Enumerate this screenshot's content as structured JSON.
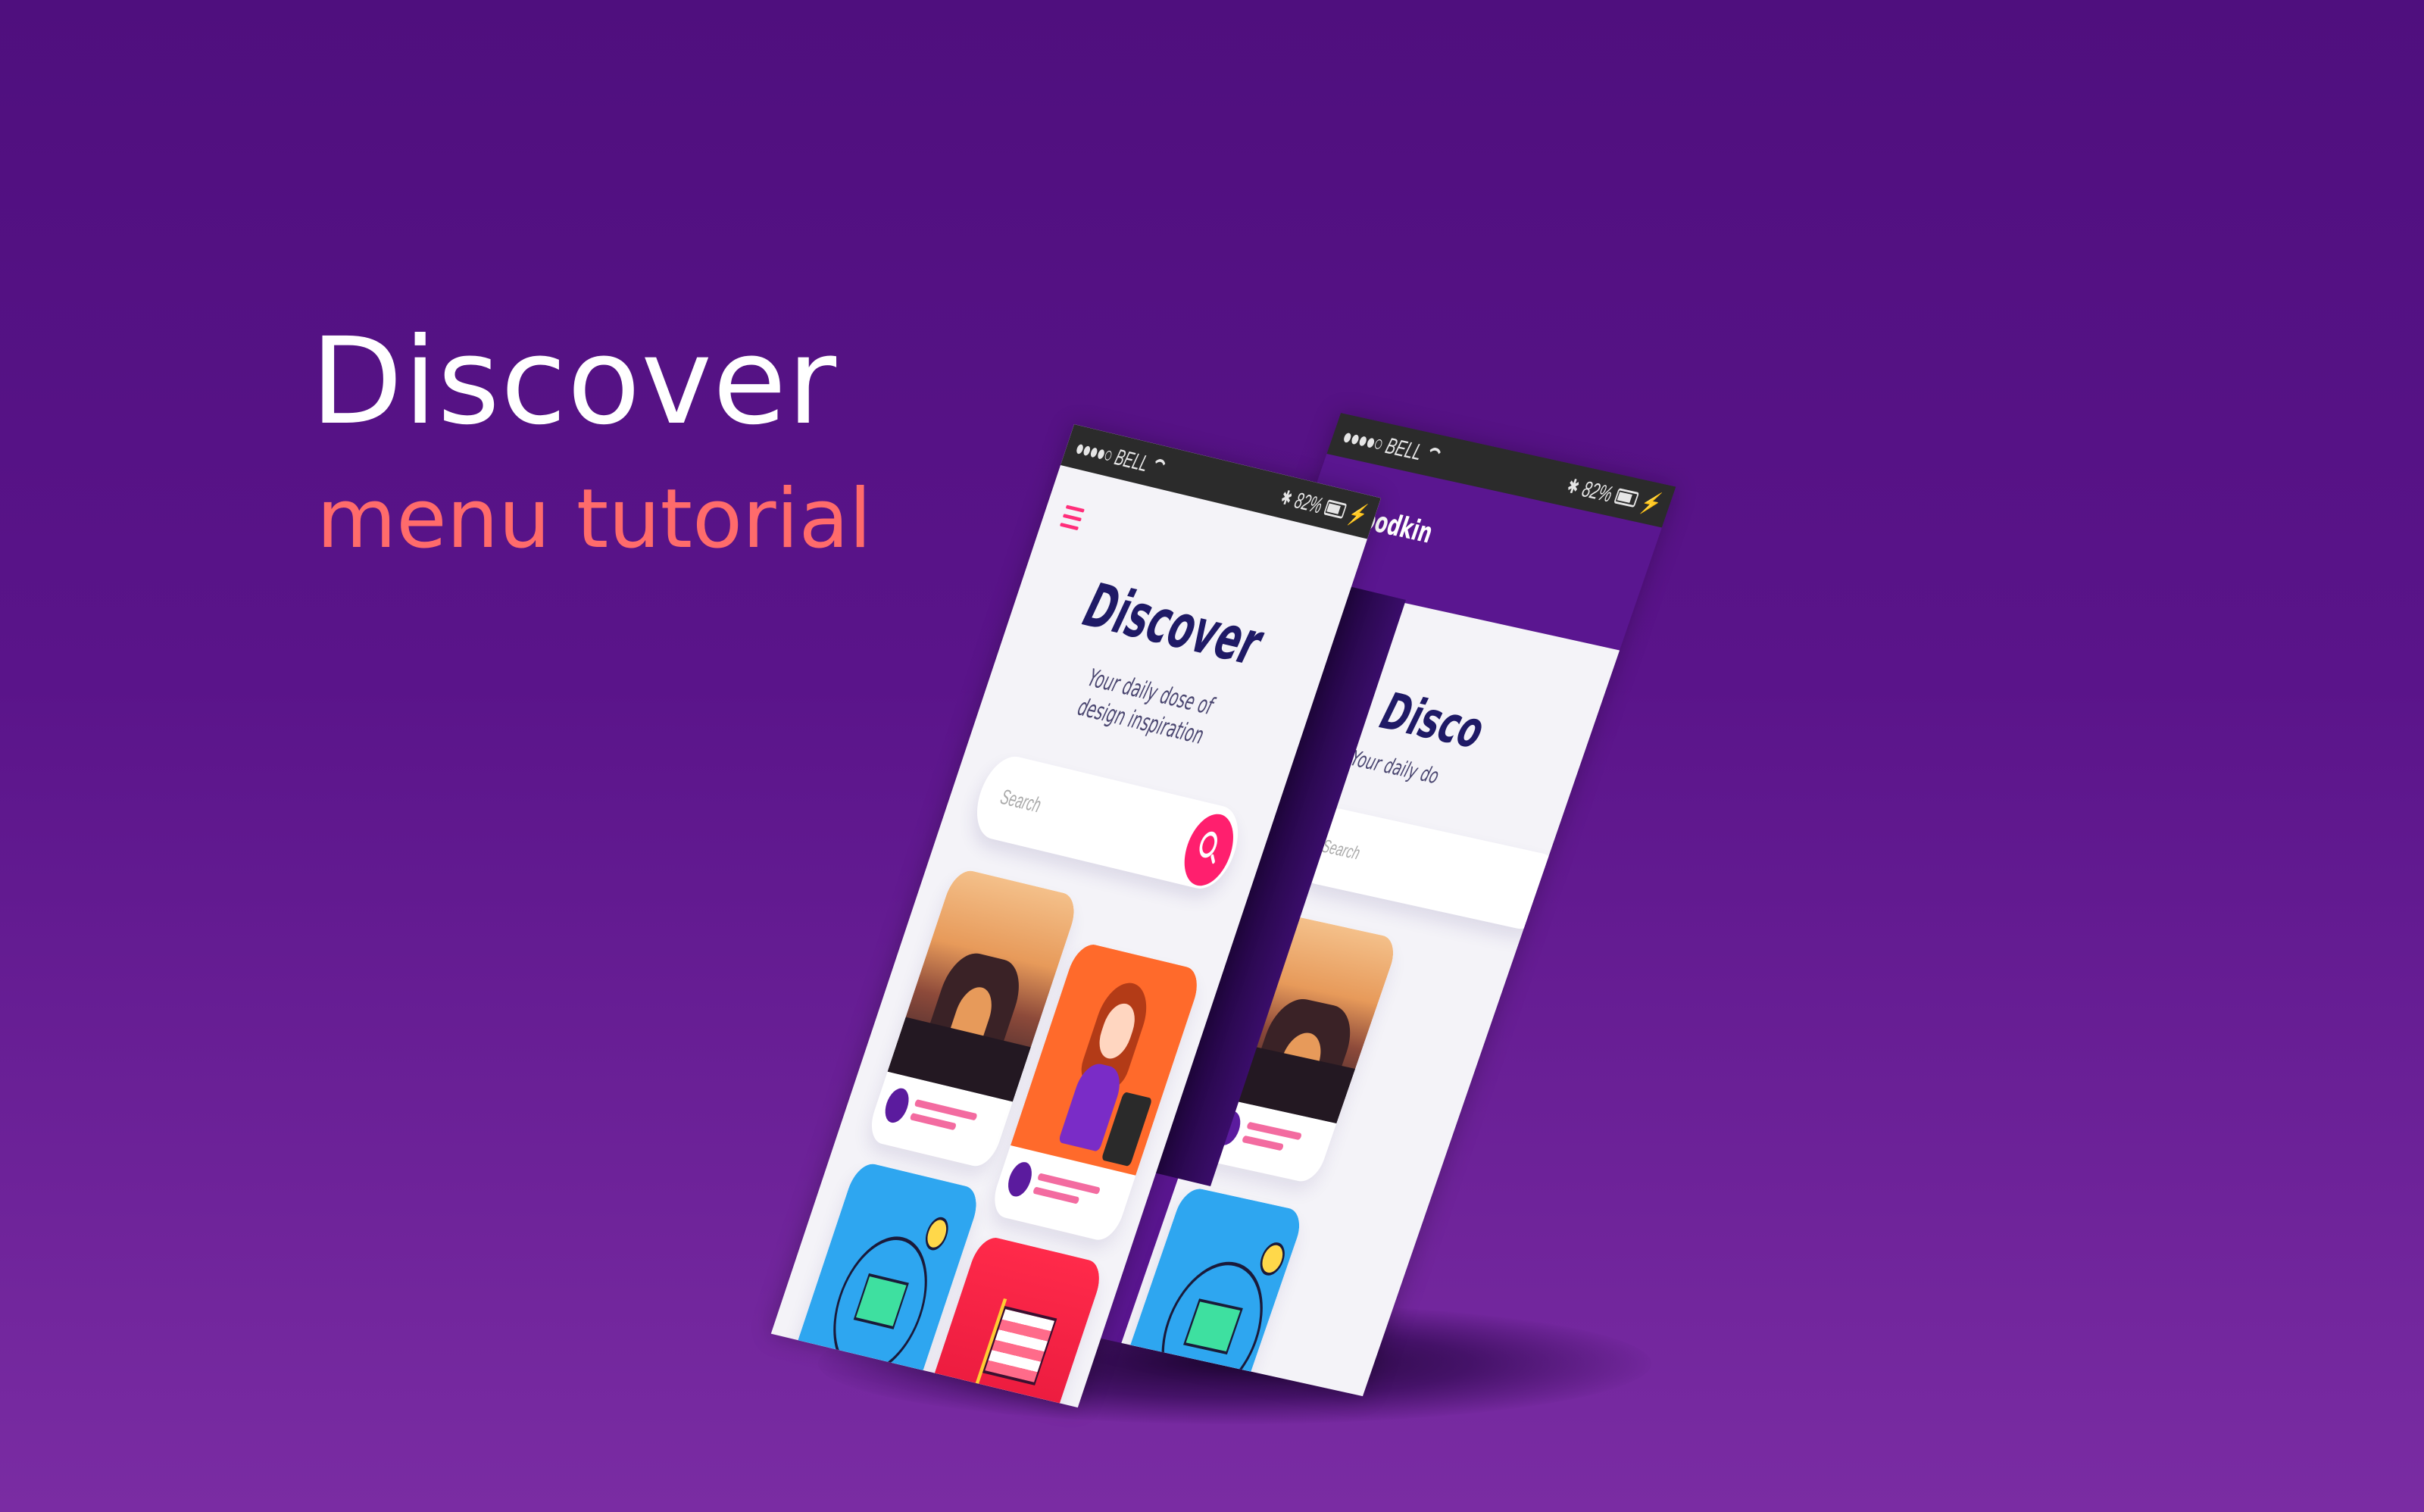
{
  "hero": {
    "title": "Discover",
    "subtitle": "menu tutorial"
  },
  "status_bar": {
    "carrier_signal": "●●●●○",
    "carrier": "BELL",
    "bluetooth": "✱",
    "battery_percent": "82%",
    "charging": "⚡"
  },
  "front_screen": {
    "title": "Discover",
    "tagline": "Your daily dose of design inspiration",
    "search_placeholder": "Search",
    "cards": [
      {
        "image": "desert-arch-illustration"
      },
      {
        "image": "singer-illustration"
      },
      {
        "image": "idea-network-illustration"
      },
      {
        "image": "flag-illustration"
      }
    ]
  },
  "back_screen": {
    "user_name": "k Woodkin",
    "close_icon": "×",
    "title": "Disco",
    "tagline": "Your daily do",
    "search_placeholder": "Search"
  },
  "colors": {
    "background": "#5a148a",
    "accent": "#ff1f6e",
    "title": "#1f1a66",
    "subtitle_hero": "#ff6b6b"
  }
}
